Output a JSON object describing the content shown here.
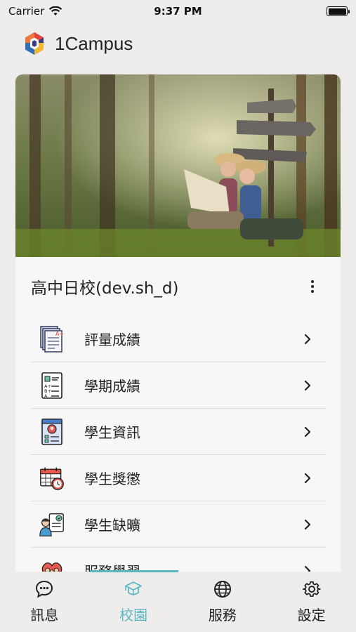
{
  "status_bar": {
    "carrier": "Carrier",
    "time": "9:37 PM"
  },
  "app": {
    "title": "1Campus",
    "logo_icon": "1campus-logo-icon"
  },
  "card": {
    "hero_image": "children-reading-map-in-forest-photo",
    "school_name": "高中日校(dev.sh_d)",
    "menu": [
      {
        "label": "評量成績",
        "icon": "exam-papers-icon"
      },
      {
        "label": "學期成績",
        "icon": "grade-report-icon"
      },
      {
        "label": "學生資訊",
        "icon": "student-profile-icon"
      },
      {
        "label": "學生獎懲",
        "icon": "calendar-clock-icon"
      },
      {
        "label": "學生缺曠",
        "icon": "attendance-icon"
      },
      {
        "label": "服務學習",
        "icon": "service-learning-icon"
      }
    ]
  },
  "tabs": [
    {
      "label": "訊息",
      "icon": "chat-icon",
      "active": false
    },
    {
      "label": "校園",
      "icon": "graduation-cap-icon",
      "active": true
    },
    {
      "label": "服務",
      "icon": "globe-icon",
      "active": false
    },
    {
      "label": "設定",
      "icon": "gear-icon",
      "active": false
    }
  ],
  "colors": {
    "accent": "#5ab8c0",
    "background": "#efedec",
    "card": "#f7f7f7"
  }
}
